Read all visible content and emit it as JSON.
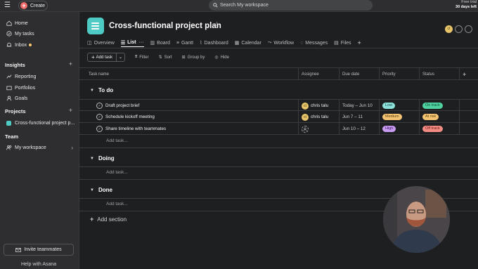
{
  "topbar": {
    "create_label": "Create",
    "search_placeholder": "Search My workspace",
    "trial_line1": "Free trial",
    "trial_line2": "30 days left"
  },
  "sidebar": {
    "items": [
      {
        "label": "Home",
        "icon": "home-icon"
      },
      {
        "label": "My tasks",
        "icon": "check-circle-icon"
      },
      {
        "label": "Inbox",
        "icon": "bell-icon"
      }
    ],
    "insights": {
      "heading": "Insights",
      "items": [
        {
          "label": "Reporting",
          "icon": "chart-icon"
        },
        {
          "label": "Portfolios",
          "icon": "folder-icon"
        },
        {
          "label": "Goals",
          "icon": "person-icon"
        }
      ]
    },
    "projects": {
      "heading": "Projects",
      "items": [
        {
          "label": "Cross-functional project p...",
          "color": "#4ecbc4"
        }
      ]
    },
    "team": {
      "heading": "Team",
      "items": [
        {
          "label": "My workspace"
        }
      ]
    },
    "invite_label": "Invite teammates",
    "help_label": "Help with Asana"
  },
  "header": {
    "title": "Cross-functional project plan",
    "avatar_initials": "ct",
    "icon_color": "#4ecbc4"
  },
  "tabs": [
    {
      "label": "Overview",
      "icon": "overview-icon",
      "active": false
    },
    {
      "label": "List",
      "icon": "list-icon",
      "active": true
    },
    {
      "label": "Board",
      "icon": "board-icon",
      "active": false
    },
    {
      "label": "Gantt",
      "icon": "gantt-icon",
      "active": false
    },
    {
      "label": "Dashboard",
      "icon": "dashboard-icon",
      "active": false
    },
    {
      "label": "Calendar",
      "icon": "calendar-icon",
      "active": false
    },
    {
      "label": "Workflow",
      "icon": "workflow-icon",
      "active": false
    },
    {
      "label": "Messages",
      "icon": "messages-icon",
      "active": false
    },
    {
      "label": "Files",
      "icon": "files-icon",
      "active": false
    }
  ],
  "toolbar": {
    "add_task": "Add task",
    "filter": "Filter",
    "sort": "Sort",
    "group_by": "Group by",
    "hide": "Hide"
  },
  "table": {
    "columns": [
      "Task name",
      "Assignee",
      "Due date",
      "Priority",
      "Status"
    ],
    "sections": [
      {
        "name": "To do",
        "tasks": [
          {
            "name": "Draft project brief",
            "assignee": "chris talu",
            "due": "Today – Jun 10",
            "priority": "Low",
            "priority_bg": "#8ee0da",
            "priority_fg": "#124f4b",
            "status": "On track",
            "status_bg": "#4fd1a0",
            "status_fg": "#0e4a34"
          },
          {
            "name": "Schedule kickoff meeting",
            "assignee": "chris talu",
            "due": "Jun 7 – 11",
            "priority": "Medium",
            "priority_bg": "#f4c473",
            "priority_fg": "#5a3d0c",
            "status": "At risk",
            "status_bg": "#f4c473",
            "status_fg": "#5a3d0c"
          },
          {
            "name": "Share timeline with teammates",
            "assignee": "",
            "due": "Jun 10 – 12",
            "priority": "High",
            "priority_bg": "#c79bf0",
            "priority_fg": "#3f1966",
            "status": "Off track",
            "status_bg": "#f28b82",
            "status_fg": "#6b1b15"
          }
        ],
        "add_task": "Add task..."
      },
      {
        "name": "Doing",
        "tasks": [],
        "add_task": "Add task..."
      },
      {
        "name": "Done",
        "tasks": [],
        "add_task": "Add task..."
      }
    ],
    "add_section": "Add section"
  }
}
